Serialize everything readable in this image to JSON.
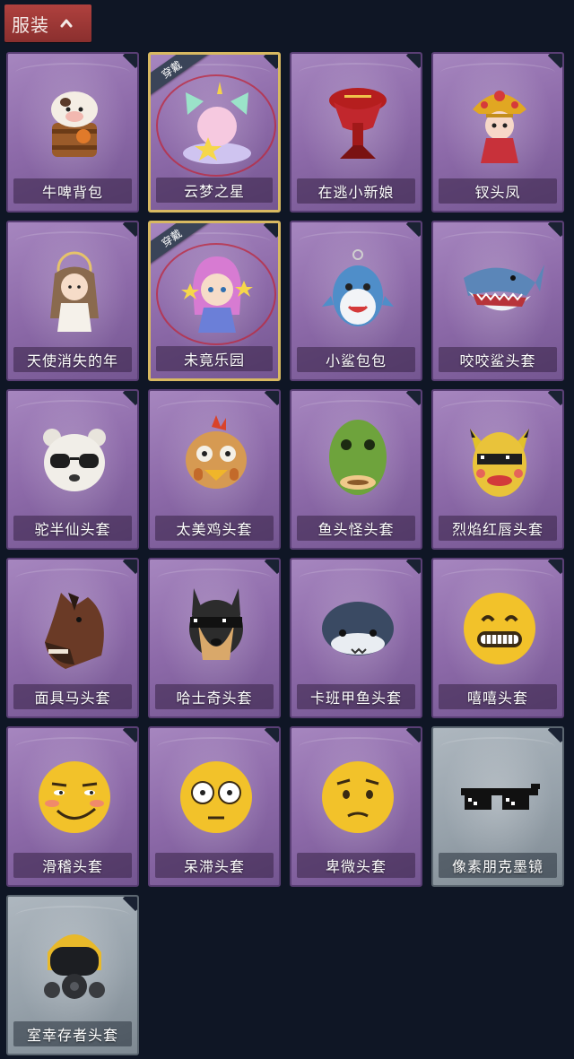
{
  "section": {
    "title": "服装",
    "toggle_icon": "chevron-up-icon"
  },
  "colors": {
    "header_bg": "#a23b39",
    "card_purple": "#8d6aa9",
    "card_grey": "#96a1aa",
    "equipped_border": "#d8b961",
    "equipped_tag_bg": "#3a4458",
    "page_bg": "#0f1625"
  },
  "equipped_tag_text": "穿戴",
  "items": [
    {
      "label": "牛啤背包",
      "icon": "cow-beer-backpack-icon",
      "equipped": false,
      "rarity": "purple"
    },
    {
      "label": "云梦之星",
      "icon": "unicorn-star-icon",
      "equipped": true,
      "rarity": "purple"
    },
    {
      "label": "在逃小新娘",
      "icon": "red-veil-icon",
      "equipped": false,
      "rarity": "purple"
    },
    {
      "label": "钗头凤",
      "icon": "phoenix-crown-icon",
      "equipped": false,
      "rarity": "purple"
    },
    {
      "label": "天使消失的年",
      "icon": "angel-doll-icon",
      "equipped": false,
      "rarity": "purple"
    },
    {
      "label": "未竟乐园",
      "icon": "pink-hair-doll-icon",
      "equipped": true,
      "rarity": "purple"
    },
    {
      "label": "小鲨包包",
      "icon": "shark-bag-icon",
      "equipped": false,
      "rarity": "purple"
    },
    {
      "label": "咬咬鲨头套",
      "icon": "shark-head-icon",
      "equipped": false,
      "rarity": "purple"
    },
    {
      "label": "驼半仙头套",
      "icon": "bear-sunglasses-icon",
      "equipped": false,
      "rarity": "purple"
    },
    {
      "label": "太美鸡头套",
      "icon": "chicken-head-icon",
      "equipped": false,
      "rarity": "purple"
    },
    {
      "label": "鱼头怪头套",
      "icon": "fish-head-icon",
      "equipped": false,
      "rarity": "purple"
    },
    {
      "label": "烈焰红唇头套",
      "icon": "yellow-pikachu-icon",
      "equipped": false,
      "rarity": "purple"
    },
    {
      "label": "面具马头套",
      "icon": "horse-mask-icon",
      "equipped": false,
      "rarity": "purple"
    },
    {
      "label": "哈士奇头套",
      "icon": "husky-head-icon",
      "equipped": false,
      "rarity": "purple"
    },
    {
      "label": "卡班甲鱼头套",
      "icon": "turtle-head-icon",
      "equipped": false,
      "rarity": "purple"
    },
    {
      "label": "嘻嘻头套",
      "icon": "grin-emoji-icon",
      "equipped": false,
      "rarity": "purple"
    },
    {
      "label": "滑稽头套",
      "icon": "smirk-emoji-icon",
      "equipped": false,
      "rarity": "purple"
    },
    {
      "label": "呆滞头套",
      "icon": "dazed-emoji-icon",
      "equipped": false,
      "rarity": "purple"
    },
    {
      "label": "卑微头套",
      "icon": "humble-emoji-icon",
      "equipped": false,
      "rarity": "purple"
    },
    {
      "label": "像素朋克墨镜",
      "icon": "pixel-sunglasses-icon",
      "equipped": false,
      "rarity": "grey"
    },
    {
      "label": "室幸存者头套",
      "icon": "gas-mask-helmet-icon",
      "equipped": false,
      "rarity": "grey"
    }
  ]
}
